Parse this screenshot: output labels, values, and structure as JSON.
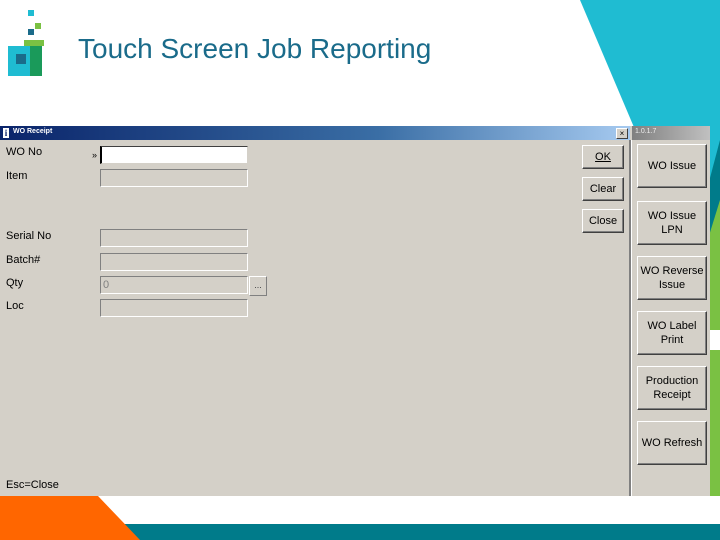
{
  "slide": {
    "title": "Touch Screen Job Reporting",
    "colors": {
      "title": "#1a6b8a",
      "cyan": "#1fbcd2",
      "teal": "#007b8a",
      "orange": "#ff6600",
      "green": "#7ac143"
    }
  },
  "window": {
    "title": "WO Receipt",
    "close_glyph": "×",
    "side_title": "1.0.1.7",
    "info_icon": "i"
  },
  "form": {
    "fields": [
      {
        "label": "WO No",
        "value": "",
        "marker": "»"
      },
      {
        "label": "Item",
        "value": ""
      },
      {
        "label": "Serial No",
        "value": ""
      },
      {
        "label": "Batch#",
        "value": ""
      },
      {
        "label": "Qty",
        "value": "0"
      },
      {
        "label": "Loc",
        "value": ""
      }
    ],
    "ellipsis_label": "...",
    "footer_hint": "Esc=Close"
  },
  "buttons": {
    "ok": "OK",
    "clear": "Clear",
    "close": "Close"
  },
  "side_buttons": [
    "WO Issue",
    "WO Issue LPN",
    "WO Reverse Issue",
    "WO Label Print",
    "Production Receipt",
    "WO Refresh"
  ]
}
